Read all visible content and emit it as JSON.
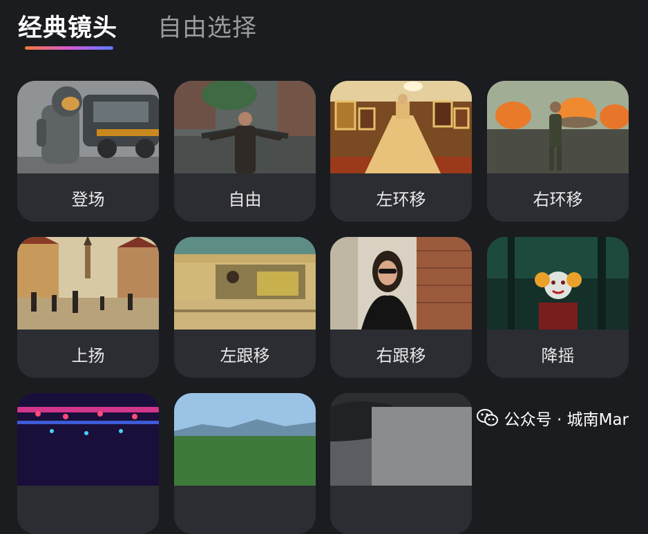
{
  "tabs": [
    {
      "label": "经典镜头",
      "active": true
    },
    {
      "label": "自由选择",
      "active": false
    }
  ],
  "accent_gradient": [
    "#f07a3a",
    "#d85ad6",
    "#5a7bff"
  ],
  "cards": [
    {
      "label": "登场",
      "icon": "astronaut-scene"
    },
    {
      "label": "自由",
      "icon": "man-in-rain-scene"
    },
    {
      "label": "左环移",
      "icon": "gallery-dress-scene"
    },
    {
      "label": "右环移",
      "icon": "soldier-explosions-scene"
    },
    {
      "label": "上扬",
      "icon": "old-town-street-scene"
    },
    {
      "label": "左跟移",
      "icon": "car-driver-scene"
    },
    {
      "label": "右跟移",
      "icon": "woman-sunglasses-scene"
    },
    {
      "label": "降摇",
      "icon": "clown-forest-scene"
    },
    {
      "label": "",
      "icon": "concert-lights-scene"
    },
    {
      "label": "",
      "icon": "field-landscape-scene"
    },
    {
      "label": "",
      "icon": "dark-road-scene"
    }
  ],
  "watermark": {
    "text": "公众号 · 城南Mar"
  }
}
